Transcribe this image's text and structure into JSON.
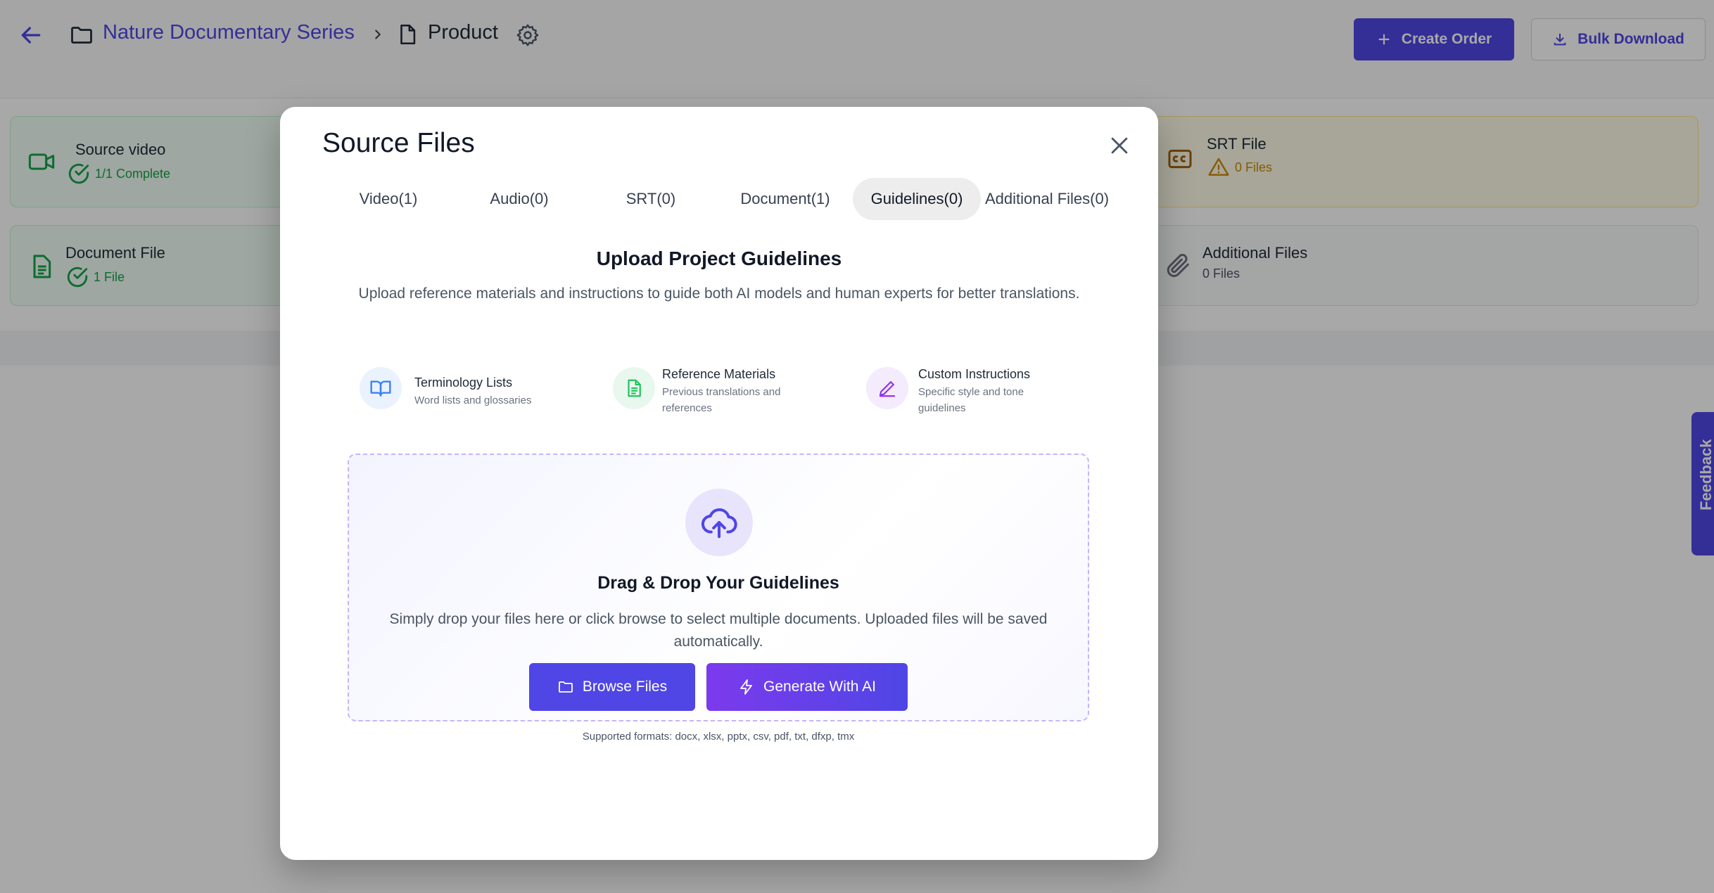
{
  "header": {
    "breadcrumb": {
      "project": "Nature Documentary Series",
      "current": "Product"
    },
    "actions": {
      "create_order": "Create Order",
      "bulk_download": "Bulk Download"
    }
  },
  "cards": {
    "source_video": {
      "title": "Source video",
      "status": "1/1 Complete"
    },
    "document_file": {
      "title": "Document File",
      "status": "1 File"
    },
    "srt_file": {
      "title": "SRT File",
      "status": "0 Files"
    },
    "additional_files": {
      "title": "Additional Files",
      "status": "0 Files"
    }
  },
  "feedback": {
    "label": "Feedback"
  },
  "modal": {
    "title": "Source Files",
    "tabs": [
      {
        "label": "Video(1)",
        "active": false
      },
      {
        "label": "Audio(0)",
        "active": false
      },
      {
        "label": "SRT(0)",
        "active": false
      },
      {
        "label": "Document(1)",
        "active": false
      },
      {
        "label": "Guidelines(0)",
        "active": true
      },
      {
        "label": "Additional Files(0)",
        "active": false
      }
    ],
    "upload": {
      "title": "Upload Project Guidelines",
      "description": "Upload reference materials and instructions to guide both AI models and human experts for better translations."
    },
    "features": [
      {
        "title": "Terminology Lists",
        "description": "Word lists and glossaries",
        "icon": "book-open-icon",
        "color": "#3b82f6"
      },
      {
        "title": "Reference Materials",
        "description": "Previous translations and references",
        "icon": "document-icon",
        "color": "#22c55e"
      },
      {
        "title": "Custom Instructions",
        "description": "Specific style and tone guidelines",
        "icon": "pencil-icon",
        "color": "#9333ea"
      }
    ],
    "dropzone": {
      "title": "Drag & Drop Your Guidelines",
      "description": "Simply drop your files here or click browse to select multiple documents. Uploaded files will be saved automatically.",
      "browse_label": "Browse Files",
      "generate_label": "Generate With AI",
      "formats": "Supported formats: docx, xlsx, pptx, csv, pdf, txt, dfxp, tmx"
    }
  },
  "colors": {
    "accent": "#4f46e5",
    "success": "#16a34a",
    "warning": "#ca8a04"
  }
}
